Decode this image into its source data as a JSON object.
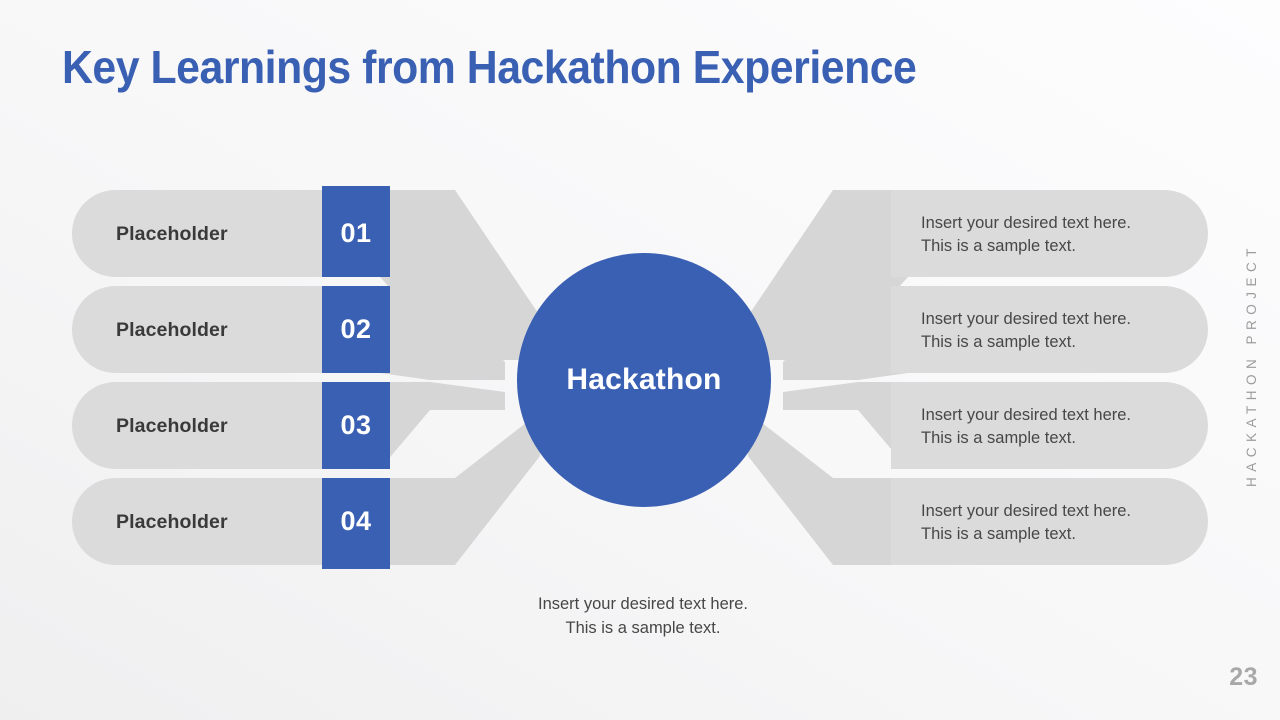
{
  "slide": {
    "title": "Key Learnings from Hackathon Experience",
    "page_number": "23",
    "side_rail_label": "HACKATHON PROJECT",
    "footer_note": "Insert your desired text here.\nThis is a sample text.",
    "colors": {
      "accent_blue": "#3A60B4",
      "shape_grey": "#DBDBDB",
      "text_dark": "#3A3A3A",
      "text_body": "#474747",
      "rail_grey": "#9C9C9C",
      "page_num_grey": "#A8A8A8",
      "white": "#FFFFFF"
    }
  },
  "hub": {
    "label": "Hackathon"
  },
  "left_items": [
    {
      "number": "01",
      "label": "Placeholder"
    },
    {
      "number": "02",
      "label": "Placeholder"
    },
    {
      "number": "03",
      "label": "Placeholder"
    },
    {
      "number": "04",
      "label": "Placeholder"
    }
  ],
  "right_items": [
    {
      "text": "Insert your desired text here.\nThis is a sample text."
    },
    {
      "text": "Insert your desired text here.\nThis is a sample text."
    },
    {
      "text": "Insert your desired text here.\nThis is a sample text."
    },
    {
      "text": "Insert your desired text here.\nThis is a sample text."
    }
  ]
}
